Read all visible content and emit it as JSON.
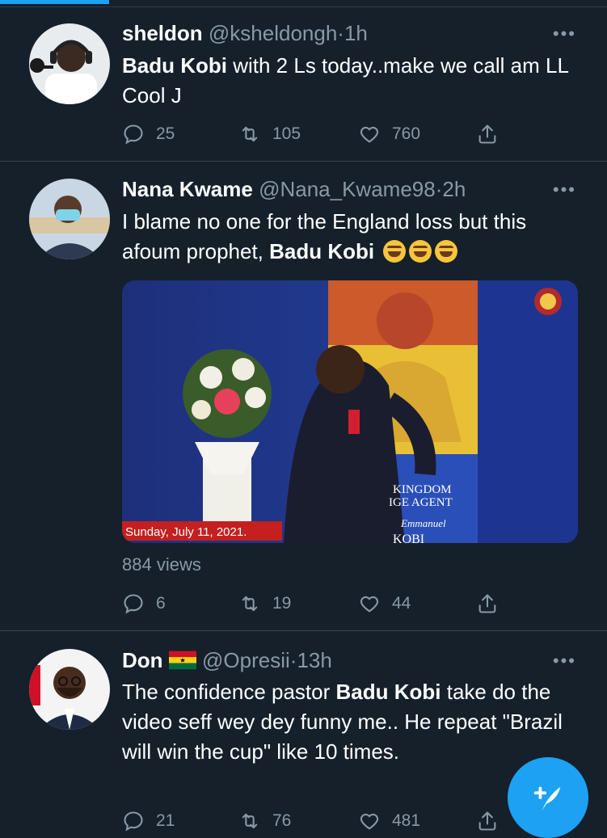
{
  "tweets": [
    {
      "name": "sheldon",
      "handle": "@ksheldongh",
      "time": "1h",
      "text_bold": "Badu Kobi",
      "text_rest": " with 2 Ls today..make we call am LL Cool J",
      "replies": "25",
      "retweets": "105",
      "likes": "760"
    },
    {
      "name": "Nana Kwame",
      "handle": "@Nana_Kwame98",
      "time": "2h",
      "text_pre": "I blame no one for the England loss but this afoum prophet, ",
      "text_bold": "Badu Kobi",
      "media": {
        "date_caption": "Sunday, July 11, 2021.",
        "banner_line1": "KINGDOM",
        "banner_line2": "IGE AGENT",
        "banner_script": "Emmanuel",
        "banner_bottom": "KOBI"
      },
      "views": "884 views",
      "replies": "6",
      "retweets": "19",
      "likes": "44"
    },
    {
      "name": "Don",
      "handle": "@Opresii",
      "time": "13h",
      "text_pre": "The confidence pastor ",
      "text_bold": "Badu Kobi",
      "text_rest": " take do the video seff wey dey funny me.. He repeat \"Brazil will win the cup\" like 10 times.",
      "replies": "21",
      "retweets": "76",
      "likes": "481"
    }
  ],
  "more_label": "•••",
  "separator": "·",
  "colors": {
    "background": "#15202b",
    "accent": "#1da1f2",
    "muted": "#8899a6"
  }
}
